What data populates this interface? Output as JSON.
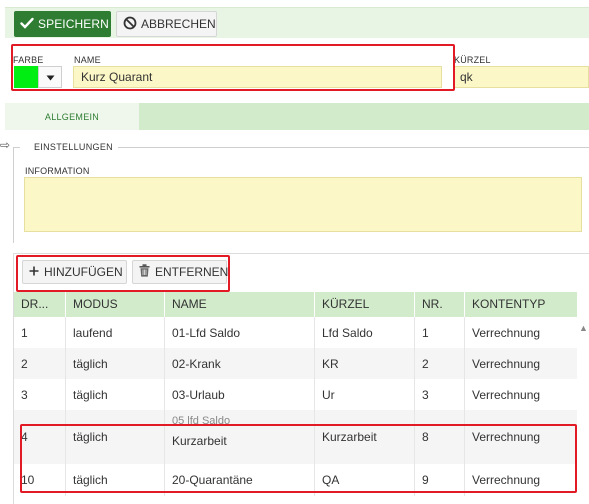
{
  "toolbar": {
    "save_label": "SPEICHERN",
    "cancel_label": "ABBRECHEN"
  },
  "form": {
    "farbe_label": "FARBE",
    "name_label": "NAME",
    "name_value": "Kurz Quarant",
    "kuerzel_label": "KÜRZEL",
    "kuerzel_value": "qk",
    "color": "#00ee11"
  },
  "tabs": [
    {
      "label": "ALLGEMEIN",
      "active": true
    }
  ],
  "settings": {
    "legend": "EINSTELLUNGEN",
    "information_label": "INFORMATION",
    "information_value": ""
  },
  "grid_toolbar": {
    "add_label": "HINZUFÜGEN",
    "remove_label": "ENTFERNEN"
  },
  "grid": {
    "columns": [
      "DR...",
      "MODUS",
      "NAME",
      "KÜRZEL",
      "NR.",
      "KONTENTYP"
    ],
    "rows": [
      {
        "dr": "1",
        "modus": "laufend",
        "name": "01-Lfd Saldo",
        "name_extra": "",
        "kuerzel": "Lfd Saldo",
        "nr": "1",
        "kontentyp": "Verrechnung"
      },
      {
        "dr": "2",
        "modus": "täglich",
        "name": "02-Krank",
        "name_extra": "",
        "kuerzel": "KR",
        "nr": "2",
        "kontentyp": "Verrechnung"
      },
      {
        "dr": "3",
        "modus": "täglich",
        "name": "03-Urlaub",
        "name_extra": "",
        "kuerzel": "Ur",
        "nr": "3",
        "kontentyp": "Verrechnung"
      },
      {
        "dr": "4",
        "modus": "täglich",
        "name": "05 lfd Saldo",
        "name_extra": "Kurzarbeit",
        "kuerzel": "Kurzarbeit",
        "nr": "8",
        "kontentyp": "Verrechnung"
      },
      {
        "dr": "10",
        "modus": "täglich",
        "name": "20-Quarantäne",
        "name_extra": "",
        "kuerzel": "QA",
        "nr": "9",
        "kontentyp": "Verrechnung"
      }
    ]
  },
  "colors": {
    "accent_green": "#2e7d32",
    "header_green": "#d2ebcb",
    "input_yellow": "#fcf7c7",
    "annotation_red": "#e21a25"
  }
}
